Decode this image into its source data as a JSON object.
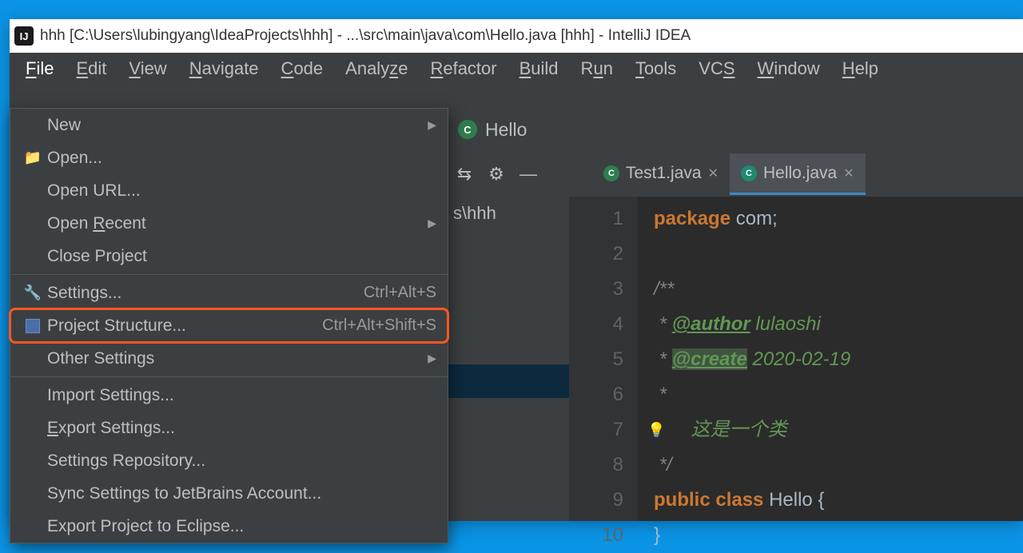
{
  "window": {
    "title": "hhh [C:\\Users\\lubingyang\\IdeaProjects\\hhh] - ...\\src\\main\\java\\com\\Hello.java [hhh] - IntelliJ IDEA"
  },
  "menubar": [
    "File",
    "Edit",
    "View",
    "Navigate",
    "Code",
    "Analyze",
    "Refactor",
    "Build",
    "Run",
    "Tools",
    "VCS",
    "Window",
    "Help"
  ],
  "file_menu": {
    "new": "New",
    "open": "Open...",
    "open_url": "Open URL...",
    "open_recent": "Open Recent",
    "close_project": "Close Project",
    "settings": "Settings...",
    "settings_sc": "Ctrl+Alt+S",
    "project_structure": "Project Structure...",
    "project_structure_sc": "Ctrl+Alt+Shift+S",
    "other_settings": "Other Settings",
    "import_settings": "Import Settings...",
    "export_settings": "Export Settings...",
    "settings_repo": "Settings Repository...",
    "sync_jb": "Sync Settings to JetBrains Account...",
    "export_eclipse": "Export Project to Eclipse..."
  },
  "breadcrumb": {
    "item": "Hello"
  },
  "toolbar": {
    "gear": "⚙",
    "minus": "—"
  },
  "tabs": [
    {
      "label": "Test1.java",
      "active": false
    },
    {
      "label": "Hello.java",
      "active": true
    }
  ],
  "project_path": "s\\hhh",
  "code": {
    "lines": [
      "1",
      "2",
      "3",
      "4",
      "5",
      "6",
      "7",
      "8",
      "9",
      "10"
    ],
    "l1_kw": "package",
    "l1_rest": " com;",
    "l3": "/**",
    "l4_star": " * ",
    "l4_tag": "@author",
    "l4_rest": " lulaoshi",
    "l5_star": " * ",
    "l5_tag": "@create",
    "l5_rest": " 2020-02-19",
    "l6": " *",
    "l7": " 这是一个类",
    "l8": " */",
    "l9_kw1": "public",
    "l9_kw2": "class",
    "l9_cls": " Hello ",
    "l9_brace": "{",
    "l10": "}"
  }
}
